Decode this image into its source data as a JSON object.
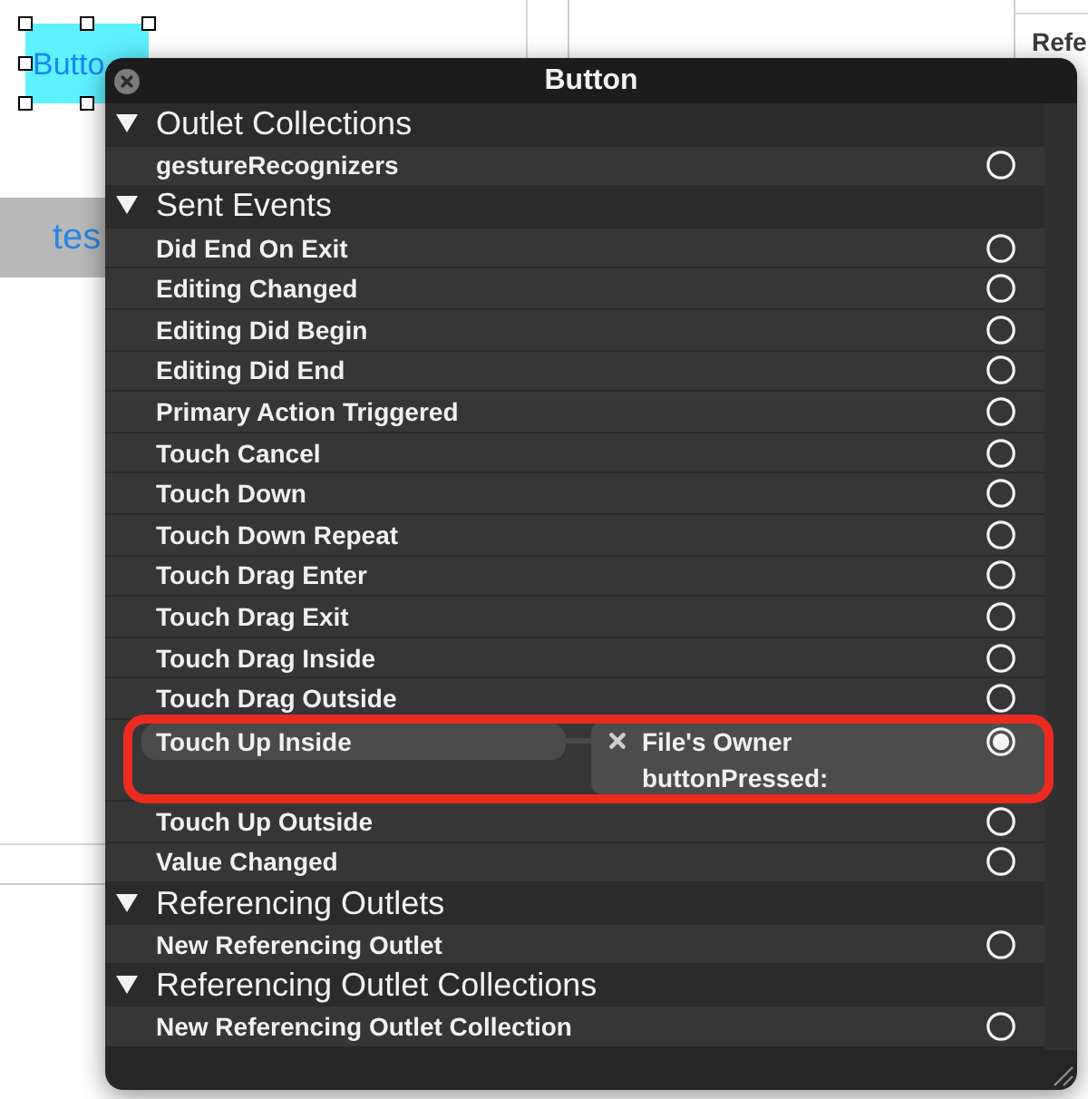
{
  "canvas": {
    "button": {
      "text": "Butto",
      "selected": true
    },
    "bar_button": {
      "text": "tes"
    }
  },
  "inspector": {
    "heading": "Refe"
  },
  "popover": {
    "title": "Button",
    "sections": [
      {
        "title": "Outlet Collections",
        "expanded": true,
        "items": [
          {
            "name": "gestureRecognizers",
            "connected": false,
            "highlighted": false
          }
        ]
      },
      {
        "title": "Sent Events",
        "expanded": true,
        "items": [
          {
            "name": "Did End On Exit",
            "connected": false,
            "highlighted": false
          },
          {
            "name": "Editing Changed",
            "connected": false,
            "highlighted": false
          },
          {
            "name": "Editing Did Begin",
            "connected": false,
            "highlighted": false
          },
          {
            "name": "Editing Did End",
            "connected": false,
            "highlighted": false
          },
          {
            "name": "Primary Action Triggered",
            "connected": false,
            "highlighted": false
          },
          {
            "name": "Touch Cancel",
            "connected": false,
            "highlighted": false
          },
          {
            "name": "Touch Down",
            "connected": false,
            "highlighted": false
          },
          {
            "name": "Touch Down Repeat",
            "connected": false,
            "highlighted": false
          },
          {
            "name": "Touch Drag Enter",
            "connected": false,
            "highlighted": false
          },
          {
            "name": "Touch Drag Exit",
            "connected": false,
            "highlighted": false
          },
          {
            "name": "Touch Drag Inside",
            "connected": false,
            "highlighted": false
          },
          {
            "name": "Touch Drag Outside",
            "connected": false,
            "highlighted": false
          },
          {
            "name": "Touch Up Inside",
            "connected": true,
            "highlighted": true,
            "connection": {
              "target": "File's Owner",
              "action": "buttonPressed:"
            }
          },
          {
            "name": "Touch Up Outside",
            "connected": false,
            "highlighted": false
          },
          {
            "name": "Value Changed",
            "connected": false,
            "highlighted": false
          }
        ]
      },
      {
        "title": "Referencing Outlets",
        "expanded": true,
        "items": [
          {
            "name": "New Referencing Outlet",
            "connected": false,
            "highlighted": false
          }
        ]
      },
      {
        "title": "Referencing Outlet Collections",
        "expanded": true,
        "items": [
          {
            "name": "New Referencing Outlet Collection",
            "connected": false,
            "highlighted": false
          }
        ]
      }
    ]
  }
}
